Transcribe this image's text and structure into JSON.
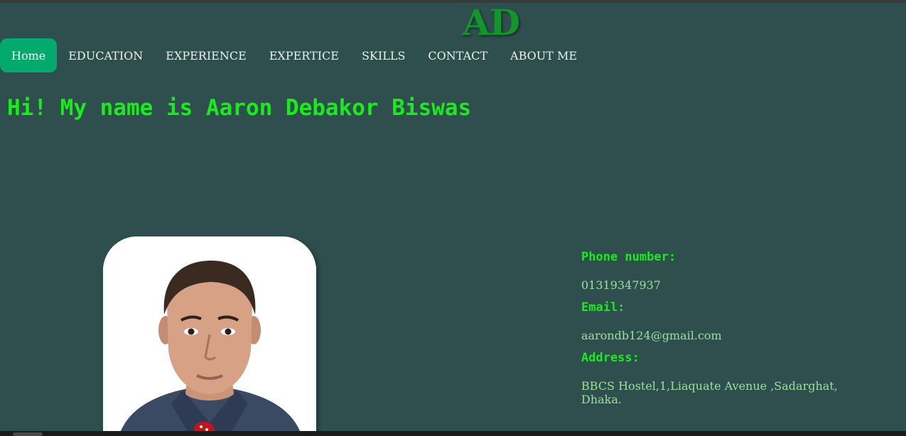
{
  "logo": "AD",
  "nav": {
    "items": [
      {
        "label": "Home",
        "active": true
      },
      {
        "label": "EDUCATION",
        "active": false
      },
      {
        "label": "EXPERIENCE",
        "active": false
      },
      {
        "label": "EXPERTICE",
        "active": false
      },
      {
        "label": "SKILLS",
        "active": false
      },
      {
        "label": "CONTACT",
        "active": false
      },
      {
        "label": "ABOUT ME",
        "active": false
      }
    ]
  },
  "hero": {
    "greeting": "Hi! My name is Aaron Debakor Biswas"
  },
  "contact": {
    "phone_label": "Phone number:",
    "phone_value": "01319347937",
    "email_label": "Email:",
    "email_value": "aarondb124@gmail.com",
    "address_label": "Address:",
    "address_value": "BBCS Hostel,1,Liaquate Avenue ,Sadarghat, Dhaka."
  },
  "colors": {
    "background": "#2f4f4f",
    "accent": "#04aa6d",
    "heading_green": "#1aeb1a",
    "logo_green": "#12952a",
    "value_green": "#9be09b"
  }
}
